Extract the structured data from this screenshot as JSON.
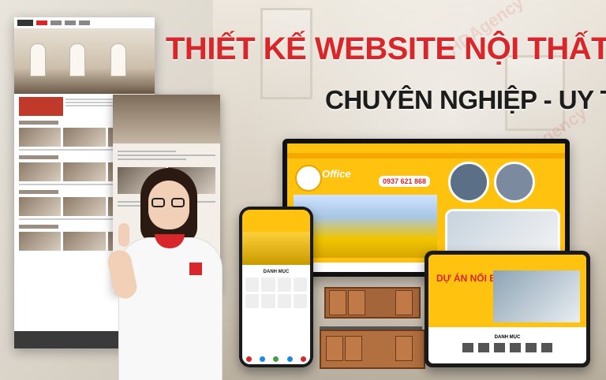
{
  "headline": {
    "line1": "THIẾT KẾ WEBSITE NỘI THẤT",
    "line2": "CHUYÊN NGHIỆP - UY TÍN"
  },
  "monitor": {
    "brand": "Office",
    "phone": "0937 621 868"
  },
  "phone": {
    "category_title": "DANH MỤC"
  },
  "tablet": {
    "hero_title": "DỰ ÁN NỔI BẬT",
    "category_title": "DANH MỤC"
  },
  "colors": {
    "headline_red": "#d8262b",
    "headline_black": "#1c1c1c",
    "brand_yellow": "#ffc20e"
  }
}
